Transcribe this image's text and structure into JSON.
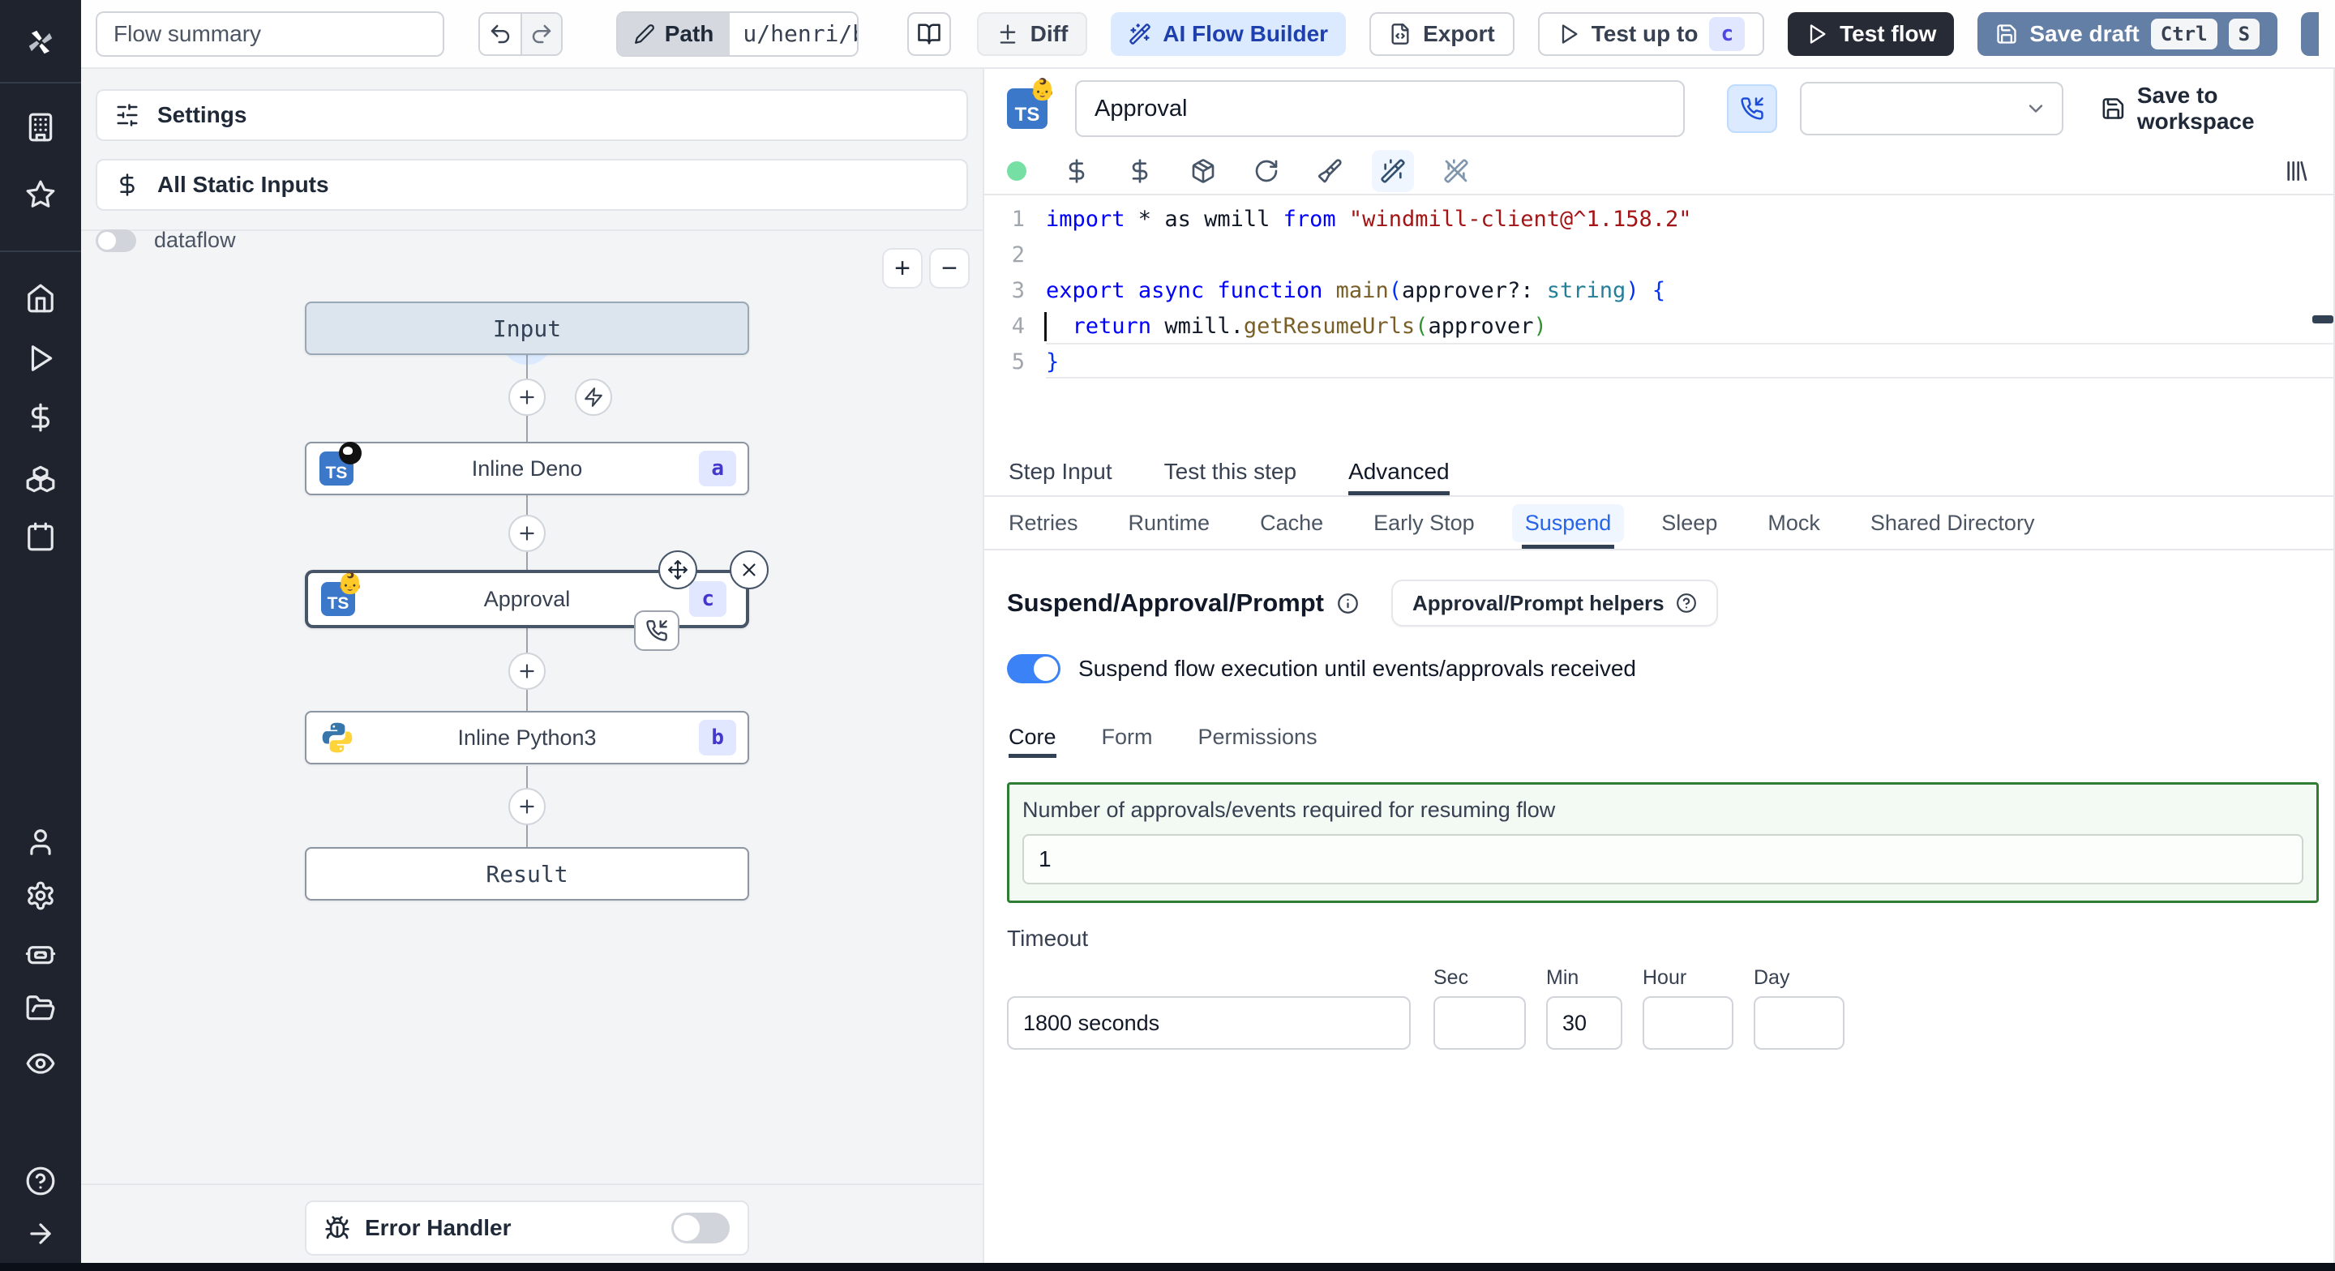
{
  "colors": {
    "sidebar_bg": "#1e232e",
    "accent_blue": "#3b82f6",
    "ai_button_bg": "#dbeafe",
    "save_draft_bg": "#647fa6",
    "test_flow_bg": "#262b36",
    "badge_bg": "#e0e7ff",
    "badge_text": "#4f46e5",
    "suspend_box_border": "#2e7d32",
    "status_dot": "#76e0a4"
  },
  "sidebar": {
    "icons": [
      "windmill-logo",
      "building",
      "star",
      "home",
      "play",
      "dollar-sign",
      "boxes",
      "calendar",
      "user",
      "settings-gear",
      "bot",
      "folder-open",
      "eye",
      "help-circle",
      "arrow-right"
    ]
  },
  "topbar": {
    "flow_summary_placeholder": "Flow summary",
    "path_label": "Path",
    "path_value": "u/henri/bes",
    "diff_label": "Diff",
    "ai_flow_builder_label": "AI Flow Builder",
    "export_label": "Export",
    "test_up_to_label": "Test up to",
    "test_up_to_badge": "c",
    "test_flow_label": "Test flow",
    "save_draft_label": "Save draft",
    "save_draft_kbd": [
      "Ctrl",
      "S"
    ]
  },
  "flow_panel": {
    "settings_label": "Settings",
    "static_inputs_label": "All Static Inputs",
    "dataflow_label": "dataflow",
    "zoom_in_label": "+",
    "zoom_out_label": "−",
    "nodes": {
      "input_label": "Input",
      "deno_label": "Inline Deno",
      "deno_badge": "a",
      "approval_label": "Approval",
      "approval_badge": "c",
      "python_label": "Inline Python3",
      "python_badge": "b",
      "result_label": "Result"
    },
    "error_handler_label": "Error Handler"
  },
  "step_editor": {
    "language_badge": "TS",
    "step_name": "Approval",
    "save_to_workspace_label": "Save to workspace",
    "code": {
      "lines": [
        [
          [
            "kw",
            "import"
          ],
          [
            "pl",
            " * as wmill "
          ],
          [
            "kw",
            "from"
          ],
          [
            "pl",
            " "
          ],
          [
            "str",
            "\"windmill-client@^1.158.2\""
          ]
        ],
        [],
        [
          [
            "kw",
            "export"
          ],
          [
            "pl",
            " "
          ],
          [
            "kw",
            "async"
          ],
          [
            "pl",
            " "
          ],
          [
            "kw",
            "function"
          ],
          [
            "pl",
            " "
          ],
          [
            "fn",
            "main"
          ],
          [
            "b1",
            "("
          ],
          [
            "pl",
            "approver?: "
          ],
          [
            "ty",
            "string"
          ],
          [
            "b1",
            ")"
          ],
          [
            "pl",
            " "
          ],
          [
            "b1",
            "{"
          ]
        ],
        [
          [
            "pl",
            "  "
          ],
          [
            "kw",
            "return"
          ],
          [
            "pl",
            " wmill."
          ],
          [
            "fn",
            "getResumeUrls"
          ],
          [
            "b2",
            "("
          ],
          [
            "pl",
            "approver"
          ],
          [
            "b2",
            ")"
          ]
        ],
        [
          [
            "b1",
            "}"
          ]
        ]
      ]
    },
    "tabs": [
      "Step Input",
      "Test this step",
      "Advanced"
    ],
    "active_tab": "Advanced",
    "advanced_tabs": [
      "Retries",
      "Runtime",
      "Cache",
      "Early Stop",
      "Suspend",
      "Sleep",
      "Mock",
      "Shared Directory"
    ],
    "active_advanced_tab": "Suspend",
    "suspend": {
      "title": "Suspend/Approval/Prompt",
      "helpers_button_label": "Approval/Prompt helpers",
      "toggle_label": "Suspend flow execution until events/approvals received",
      "tabs": [
        "Core",
        "Form",
        "Permissions"
      ],
      "active_tab": "Core",
      "approvals_label": "Number of approvals/events required for resuming flow",
      "approvals_value": "1",
      "timeout_label": "Timeout",
      "timeout_value": "1800 seconds",
      "timeout_units": [
        {
          "label": "Sec",
          "value": ""
        },
        {
          "label": "Min",
          "value": "30"
        },
        {
          "label": "Hour",
          "value": ""
        },
        {
          "label": "Day",
          "value": ""
        }
      ]
    }
  }
}
